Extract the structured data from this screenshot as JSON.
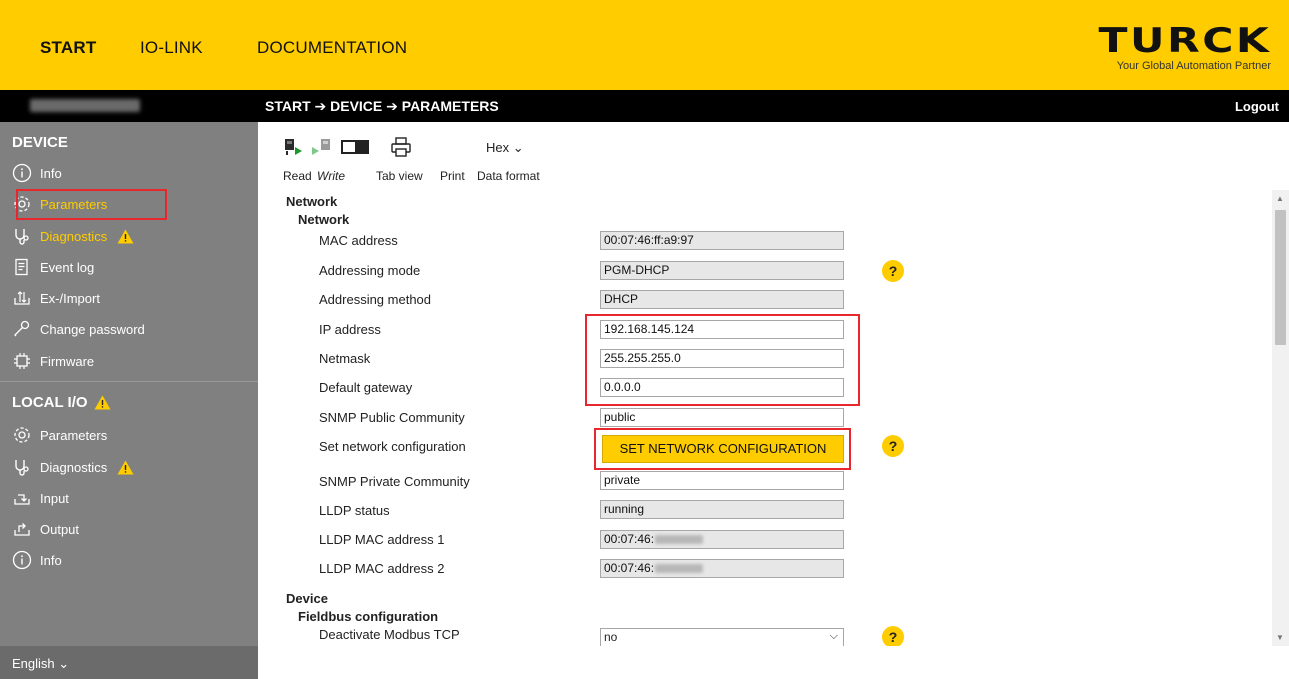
{
  "topnav": {
    "start": "START",
    "iolink": "IO-LINK",
    "documentation": "DOCUMENTATION"
  },
  "brand": {
    "logo": "TURCK",
    "tagline": "Your Global Automation Partner",
    "color": "#ffcc00"
  },
  "header": {
    "breadcrumb": "START ➔ DEVICE ➔ PARAMETERS",
    "logout": "Logout"
  },
  "sidebar": {
    "device_section": "DEVICE",
    "device_items": [
      {
        "label": "Info",
        "icon": "info-icon"
      },
      {
        "label": "Parameters",
        "icon": "gear-icon",
        "active": true
      },
      {
        "label": "Diagnostics",
        "icon": "stethoscope-icon",
        "warning": true
      },
      {
        "label": "Event log",
        "icon": "log-icon"
      },
      {
        "label": "Ex-/Import",
        "icon": "import-export-icon"
      },
      {
        "label": "Change password",
        "icon": "key-icon"
      },
      {
        "label": "Firmware",
        "icon": "chip-icon"
      }
    ],
    "local_section": "LOCAL I/O",
    "local_items": [
      {
        "label": "Parameters",
        "icon": "gear-icon"
      },
      {
        "label": "Diagnostics",
        "icon": "stethoscope-icon",
        "warning": true
      },
      {
        "label": "Input",
        "icon": "input-icon"
      },
      {
        "label": "Output",
        "icon": "output-icon"
      },
      {
        "label": "Info",
        "icon": "info-icon"
      }
    ],
    "language": "English ⌄"
  },
  "toolbar": {
    "read": "Read",
    "write": "Write",
    "tabview": "Tab view",
    "print": "Print",
    "dataformat": "Data format",
    "format_value": "Hex ⌄"
  },
  "network": {
    "section": "Network",
    "subsection": "Network",
    "rows": [
      {
        "label": "MAC address",
        "value": "00:07:46:ff:a9:97"
      },
      {
        "label": "Addressing mode",
        "value": "PGM-DHCP"
      },
      {
        "label": "Addressing method",
        "value": "DHCP"
      },
      {
        "label": "IP address",
        "value": "192.168.145.124"
      },
      {
        "label": "Netmask",
        "value": "255.255.255.0"
      },
      {
        "label": "Default gateway",
        "value": "0.0.0.0"
      },
      {
        "label": "SNMP Public Community",
        "value": "public"
      },
      {
        "label": "Set network configuration",
        "button": "SET NETWORK CONFIGURATION"
      },
      {
        "label": "SNMP Private Community",
        "value": "private"
      },
      {
        "label": "LLDP status",
        "value": "running"
      },
      {
        "label": "LLDP MAC address 1",
        "value": "00:07:46:"
      },
      {
        "label": "LLDP MAC address 2",
        "value": "00:07:46:"
      }
    ]
  },
  "device": {
    "section": "Device",
    "subsection": "Fieldbus configuration",
    "rows": [
      {
        "label": "Deactivate Modbus TCP",
        "value": "no"
      }
    ]
  },
  "help_symbol": "?"
}
